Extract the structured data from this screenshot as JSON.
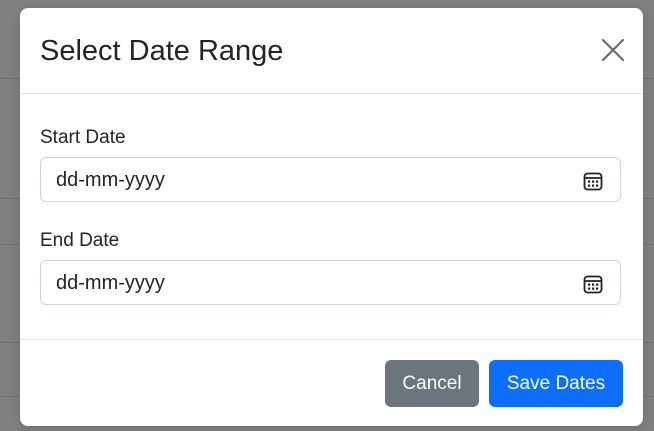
{
  "modal": {
    "title": "Select Date Range",
    "start_label": "Start Date",
    "start_value": "dd-mm-yyyy",
    "end_label": "End Date",
    "end_value": "dd-mm-yyyy",
    "cancel_label": "Cancel",
    "save_label": "Save Dates"
  },
  "icons": {
    "close": "close-icon",
    "calendar": "calendar-icon"
  },
  "colors": {
    "primary": "#0d6efd",
    "secondary": "#6c757d",
    "overlay": "#808080"
  }
}
